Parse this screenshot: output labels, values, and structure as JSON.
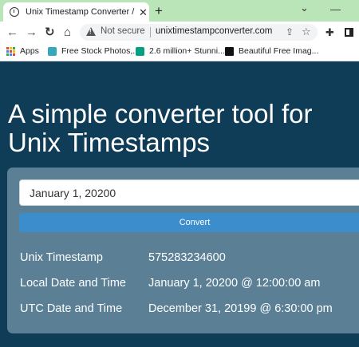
{
  "browser": {
    "tab_title": "Unix Timestamp Converter / Epoch",
    "tab_close": "✕",
    "new_tab": "+",
    "minimize": "⌄",
    "maximize": "—",
    "security_label": "Not secure",
    "url": "unixtimestampconverter.com",
    "bookmarks": [
      {
        "label": "Apps"
      },
      {
        "label": "Free Stock Photos,..."
      },
      {
        "label": "2.6 million+ Stunni..."
      },
      {
        "label": "Beautiful Free Imag..."
      }
    ],
    "icons": {
      "back": "arrow-left",
      "forward": "arrow-right",
      "reload": "reload",
      "home": "home",
      "warning": "warning-triangle",
      "share": "share",
      "bookmark": "star",
      "extensions": "puzzle",
      "side_panel": "side-panel"
    }
  },
  "page": {
    "headline": "A simple converter tool for Unix Timestamps",
    "converter": {
      "input_value": "January 1, 20200",
      "convert_label": "Convert",
      "results": [
        {
          "label": "Unix Timestamp",
          "value": "575283234600"
        },
        {
          "label": "Local Date and Time",
          "value": "January 1, 20200 @ 12:00:00 am"
        },
        {
          "label": "UTC Date and Time",
          "value": "December 31, 20199 @ 6:30:00 pm"
        }
      ]
    }
  },
  "colors": {
    "tab_strip": "#b9e5b9",
    "page_background": "#0f3d57",
    "card_background": "#5b7f95",
    "button_accent": "#3c8dcc"
  }
}
